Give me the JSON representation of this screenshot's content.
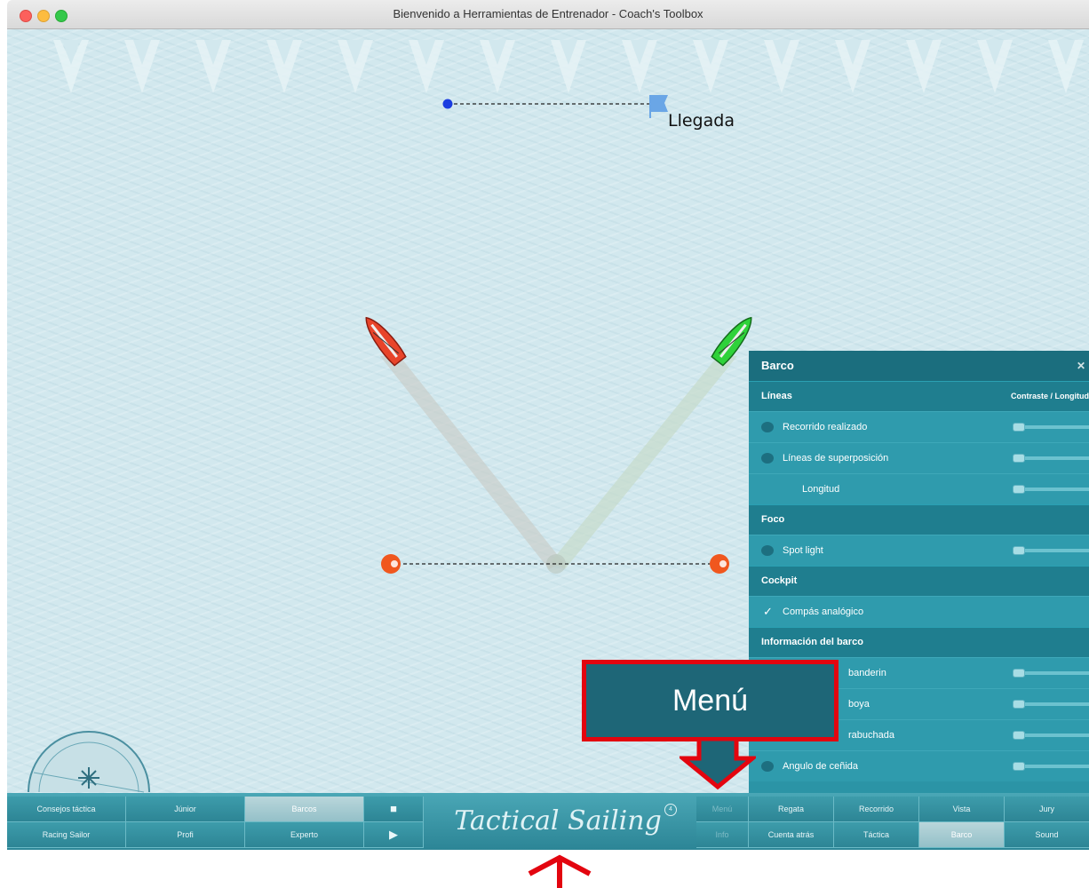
{
  "window": {
    "title": "Bienvenido a Herramientas de Entrenador - Coach's Toolbox"
  },
  "scene": {
    "finish_label": "Llegada",
    "boats": [
      {
        "name": "red-boat",
        "color": "#e8442a"
      },
      {
        "name": "green-boat",
        "color": "#2fd23a"
      }
    ],
    "colors": {
      "finish_pin": "#1b3de0",
      "flag": "#6aa6e6",
      "start_buoy": "#f0571e"
    }
  },
  "panel": {
    "title": "Barco",
    "close_icon": "close-icon",
    "sections": {
      "lineas": "Líneas",
      "contrast_header": "Contraste / Longitud",
      "foco": "Foco",
      "cockpit": "Cockpit",
      "info": "Información del barco"
    },
    "rows": {
      "recorrido": "Recorrido realizado",
      "superposicion": "Líneas de superposición",
      "longitud": "Longitud",
      "spot": "Spot light",
      "compas": "Compás analógico",
      "banderin": "banderin",
      "boya": "boya",
      "trabuchada": "rabuchada",
      "cenida": "Angulo de ceñida"
    }
  },
  "toolbar": {
    "left_row1": [
      "Consejos táctica",
      "Júnior",
      "Barcos"
    ],
    "left_row2": [
      "Racing Sailor",
      "Profi",
      "Experto"
    ],
    "stop_icon": "stop-icon",
    "play_icon": "play-icon",
    "brand": "Tactical Sailing",
    "menu": "Menú",
    "info": "Info",
    "right_row1": [
      "Regata",
      "Recorrido",
      "Vista",
      "Jury"
    ],
    "right_row2": [
      "Cuenta atrás",
      "Táctica",
      "Barco",
      "Sound"
    ],
    "selected": [
      "Barcos",
      "Barco"
    ]
  },
  "annotation": {
    "callout_text": "Menú",
    "color": "#e3050f"
  }
}
